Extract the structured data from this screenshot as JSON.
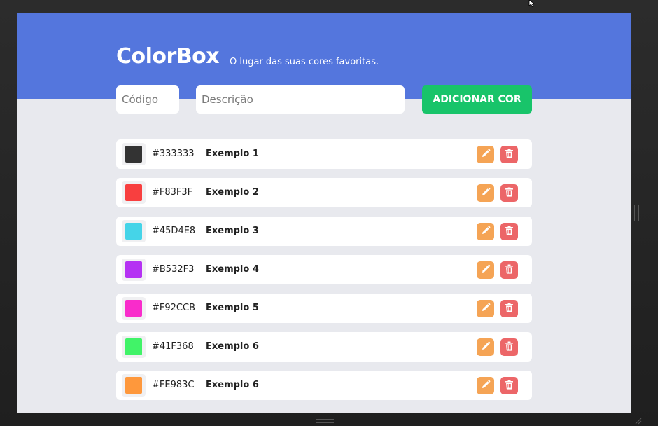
{
  "header": {
    "title": "ColorBox",
    "tagline": "O lugar das suas cores favoritas."
  },
  "form": {
    "code_placeholder": "Código",
    "description_placeholder": "Descrição",
    "add_label": "ADICIONAR COR"
  },
  "theme": {
    "header_bg": "#5476dd",
    "page_bg": "#e8e9ee",
    "add_button": "#18c46a",
    "edit_button": "#f5a455",
    "delete_button": "#ec6668"
  },
  "colors": [
    {
      "hex": "#333333",
      "name": "Exemplo 1"
    },
    {
      "hex": "#F83F3F",
      "name": "Exemplo 2"
    },
    {
      "hex": "#45D4E8",
      "name": "Exemplo 3"
    },
    {
      "hex": "#B532F3",
      "name": "Exemplo 4"
    },
    {
      "hex": "#F92CCB",
      "name": "Exemplo 5"
    },
    {
      "hex": "#41F368",
      "name": "Exemplo 6"
    },
    {
      "hex": "#FE983C",
      "name": "Exemplo 6"
    }
  ],
  "row_icons": {
    "edit": "pencil-icon",
    "delete": "trash-icon"
  }
}
